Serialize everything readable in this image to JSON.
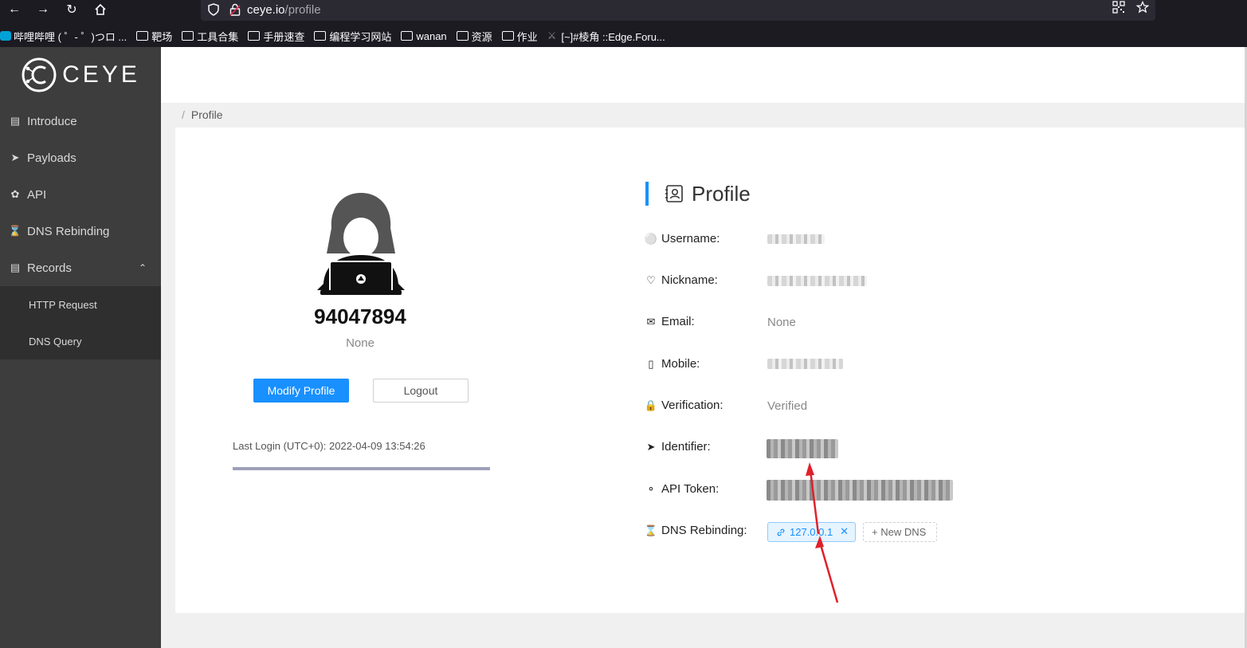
{
  "browser": {
    "url_host": "ceye.io",
    "url_path": "/profile",
    "bookmarks": [
      {
        "label": "哔哩哔哩 ( ゜- ゜)つロ ...",
        "type": "site"
      },
      {
        "label": "靶场",
        "type": "folder"
      },
      {
        "label": "工具合集",
        "type": "folder"
      },
      {
        "label": "手册速查",
        "type": "folder"
      },
      {
        "label": "编程学习网站",
        "type": "folder"
      },
      {
        "label": "wanan",
        "type": "folder"
      },
      {
        "label": "资源",
        "type": "folder"
      },
      {
        "label": "作业",
        "type": "folder"
      },
      {
        "label": "[~]#棱角 ::Edge.Foru...",
        "type": "site"
      }
    ]
  },
  "sidebar": {
    "logo_text": "CEYE",
    "items": [
      {
        "label": "Introduce",
        "icon": "book-icon"
      },
      {
        "label": "Payloads",
        "icon": "rocket-icon"
      },
      {
        "label": "API",
        "icon": "api-icon"
      },
      {
        "label": "DNS Rebinding",
        "icon": "hourglass-icon"
      },
      {
        "label": "Records",
        "icon": "list-icon",
        "expanded": true
      }
    ],
    "subitems": [
      "HTTP Request",
      "DNS Query"
    ]
  },
  "breadcrumb": {
    "sep": "/",
    "current": "Profile"
  },
  "user_card": {
    "id": "94047894",
    "subtitle": "None",
    "modify_label": "Modify Profile",
    "logout_label": "Logout",
    "last_login_label": "Last Login (UTC+0):",
    "last_login_value": "2022-04-09 13:54:26"
  },
  "profile": {
    "title": "Profile",
    "fields": {
      "username": "Username:",
      "nickname": "Nickname:",
      "email": "Email:",
      "mobile": "Mobile:",
      "verification": "Verification:",
      "identifier": "Identifier:",
      "api_token": "API Token:",
      "dns_rebinding": "DNS Rebinding:"
    },
    "email_value": "None",
    "verification_value": "Verified",
    "dns_tag": "127.0.0.1",
    "new_dns_label": "+ New DNS"
  },
  "colors": {
    "accent": "#1890ff",
    "sidebar": "#3d3d3d",
    "annotation": "#e0202a"
  }
}
